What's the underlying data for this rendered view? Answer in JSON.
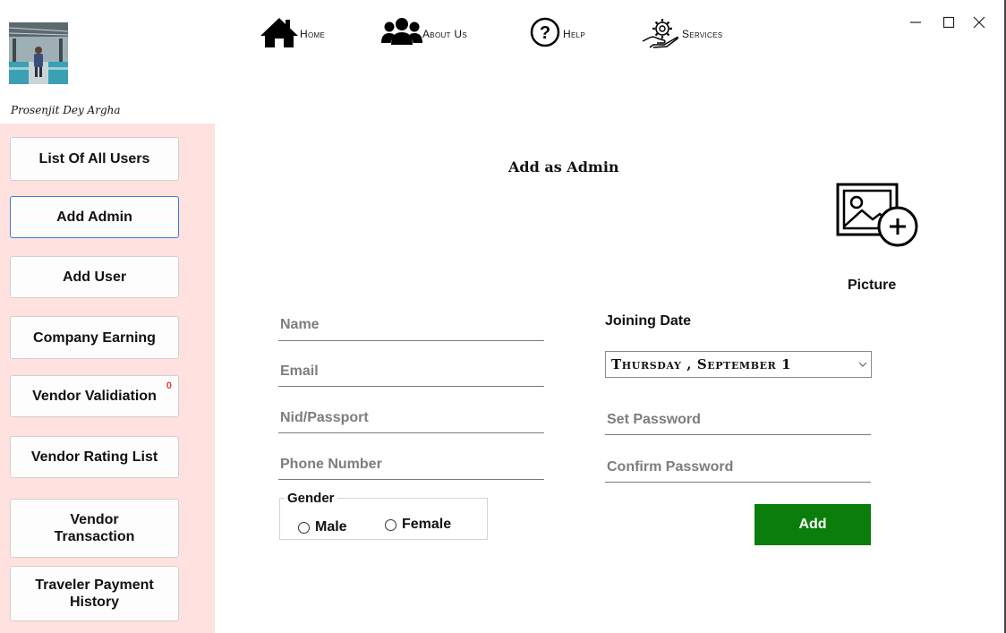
{
  "profile": {
    "name": "Prosenjit Dey Argha"
  },
  "nav": [
    {
      "label": "Home",
      "icon": "home-icon"
    },
    {
      "label": "About Us",
      "icon": "users-icon"
    },
    {
      "label": "Help",
      "icon": "help-icon"
    },
    {
      "label": "Services",
      "icon": "services-icon"
    }
  ],
  "window_controls": [
    "minimize",
    "maximize",
    "close"
  ],
  "sidebar": {
    "items": [
      {
        "label": "List Of All Users"
      },
      {
        "label": "Add Admin",
        "active": true
      },
      {
        "label": "Add User"
      },
      {
        "label": "Company Earning"
      },
      {
        "label": "Vendor Validiation",
        "badge": "0"
      },
      {
        "label": "Vendor Rating List"
      },
      {
        "label": "Vendor Transaction"
      },
      {
        "label": "Traveler Payment History"
      }
    ]
  },
  "main": {
    "title": "Add as Admin",
    "picture_label": "Picture",
    "fields": {
      "name": {
        "placeholder": "Name",
        "value": ""
      },
      "email": {
        "placeholder": "Email",
        "value": ""
      },
      "nid": {
        "placeholder": "Nid/Passport",
        "value": ""
      },
      "phone": {
        "placeholder": "Phone Number",
        "value": ""
      },
      "set_password": {
        "placeholder": "Set Password",
        "value": ""
      },
      "confirm_password": {
        "placeholder": "Confirm Password",
        "value": ""
      }
    },
    "joining_date": {
      "label": "Joining Date",
      "value": "Thursday , September 1"
    },
    "gender": {
      "label": "Gender",
      "options": [
        "Male",
        "Female"
      ]
    },
    "add_label": "Add"
  },
  "colors": {
    "sidebar_bg": "#ffe1df",
    "add_button": "#0a7d0a",
    "active_border": "#3c7fd6",
    "badge": "#e23b3b"
  }
}
